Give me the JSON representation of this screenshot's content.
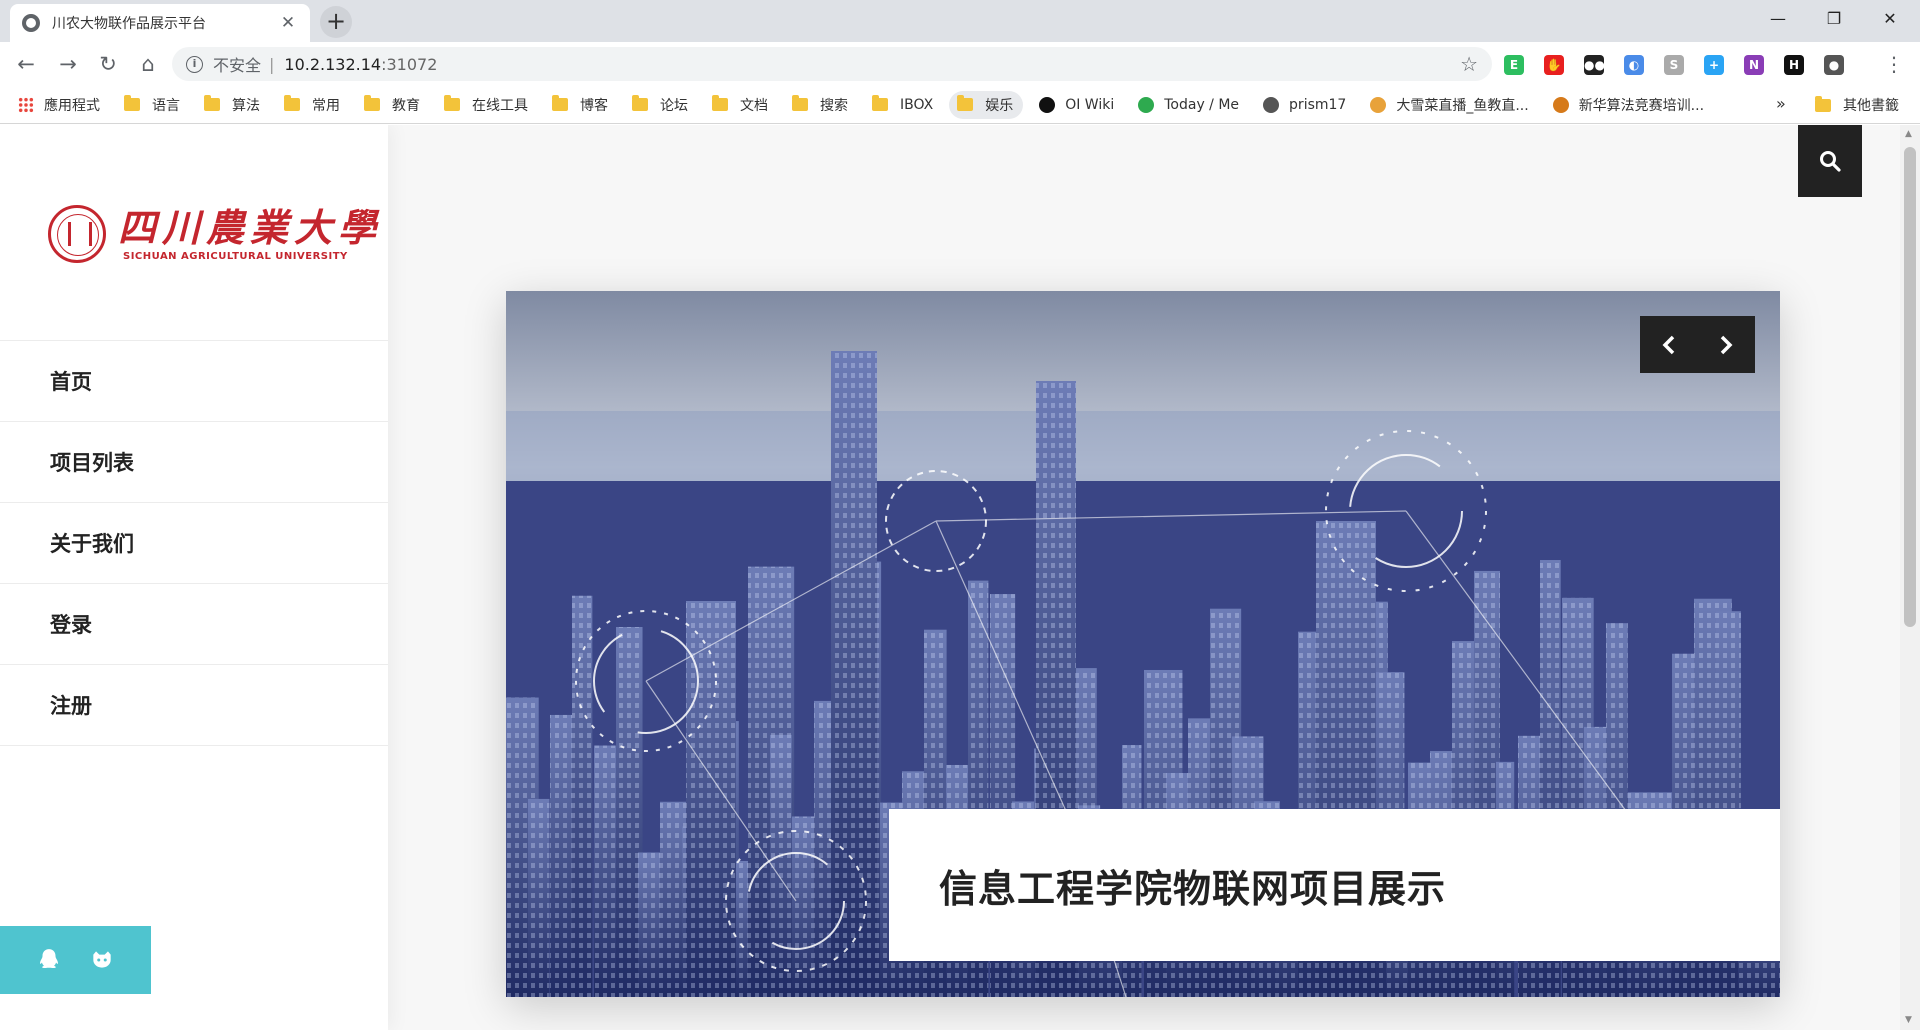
{
  "browser": {
    "tab_title": "川农大物联作品展示平台",
    "tab_close": "✕",
    "new_tab": "+",
    "window": {
      "minimize": "—",
      "maximize": "❐",
      "close": "✕"
    },
    "nav": {
      "back": "←",
      "forward": "→",
      "reload": "↻",
      "home": "⌂"
    },
    "address": {
      "insecure_label": "不安全",
      "separator": "|",
      "host": "10.2.132.14",
      "port": ":31072",
      "bookmark_star": "☆"
    },
    "extensions": [
      {
        "name": "evernote-ext-icon",
        "label": "E",
        "color": "#2dbe60"
      },
      {
        "name": "adblock-ext-icon",
        "label": "✋",
        "color": "#e8201f"
      },
      {
        "name": "tampermonkey-ext-icon",
        "label": "●●",
        "color": "#222222"
      },
      {
        "name": "edge-ext-icon",
        "label": "◐",
        "color": "#4a8be8"
      },
      {
        "name": "s-ext-icon",
        "label": "S",
        "color": "#aaaaaa"
      },
      {
        "name": "plus-ext-icon",
        "label": "+",
        "color": "#2aa4f4"
      },
      {
        "name": "onenote-ext-icon",
        "label": "N",
        "color": "#8a3db6"
      },
      {
        "name": "h-ext-icon",
        "label": "H",
        "color": "#111111"
      },
      {
        "name": "profile-avatar-icon",
        "label": "●",
        "color": "#555555"
      }
    ],
    "menu": "⋮",
    "bookmarks": [
      {
        "label": "應用程式",
        "type": "apps"
      },
      {
        "label": "语言",
        "type": "folder"
      },
      {
        "label": "算法",
        "type": "folder"
      },
      {
        "label": "常用",
        "type": "folder"
      },
      {
        "label": "教育",
        "type": "folder"
      },
      {
        "label": "在线工具",
        "type": "folder"
      },
      {
        "label": "博客",
        "type": "folder"
      },
      {
        "label": "论坛",
        "type": "folder"
      },
      {
        "label": "文档",
        "type": "folder"
      },
      {
        "label": "搜索",
        "type": "folder"
      },
      {
        "label": "IBOX",
        "type": "folder"
      },
      {
        "label": "娱乐",
        "type": "folder-highlight"
      },
      {
        "label": "OI Wiki",
        "type": "site",
        "color": "#111111"
      },
      {
        "label": "Today / Me",
        "type": "site",
        "color": "#2eaa4f"
      },
      {
        "label": "prism17",
        "type": "site",
        "color": "#555555"
      },
      {
        "label": "大雪菜直播_鱼教直...",
        "type": "site",
        "color": "#e8a23a"
      },
      {
        "label": "新华算法竞赛培训...",
        "type": "site",
        "color": "#d67a1a"
      }
    ],
    "more": "»",
    "other_bookmarks": "其他書籤"
  },
  "site": {
    "logo": {
      "cn": "四川農業大學",
      "en": "SICHUAN AGRICULTURAL UNIVERSITY"
    },
    "nav": [
      "首页",
      "项目列表",
      "关于我们",
      "登录",
      "注册"
    ],
    "hero": {
      "caption": "信息工程学院物联网项目展示"
    },
    "colors": {
      "social_bg": "#4fc4cf",
      "logo_red": "#c4262e",
      "dark": "#222222"
    }
  }
}
